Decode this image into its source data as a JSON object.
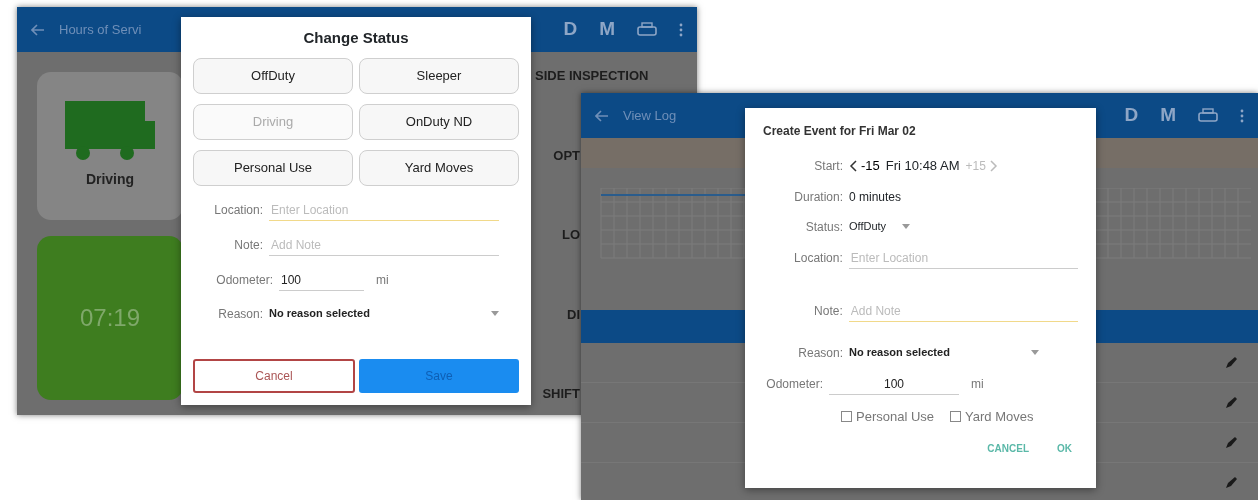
{
  "hours_of_service_screen": {
    "app_bar": {
      "title": "Hours of Servi",
      "buttons": [
        "D",
        "M"
      ]
    },
    "status_card": {
      "label": "Driving"
    },
    "timer_card": {
      "time": "07:19"
    },
    "side_labels": [
      "SIDE INSPECTION",
      "OPT",
      "LO",
      "DI",
      "SHIFT"
    ],
    "change_status_dialog": {
      "title": "Change Status",
      "status_buttons": [
        {
          "label": "OffDuty",
          "disabled": false
        },
        {
          "label": "Sleeper",
          "disabled": false
        },
        {
          "label": "Driving",
          "disabled": true
        },
        {
          "label": "OnDuty ND",
          "disabled": false
        },
        {
          "label": "Personal Use",
          "disabled": false
        },
        {
          "label": "Yard Moves",
          "disabled": false
        }
      ],
      "location": {
        "label": "Location:",
        "placeholder": "Enter Location",
        "focused": true
      },
      "note": {
        "label": "Note:",
        "placeholder": "Add Note",
        "focused": false
      },
      "odometer": {
        "label": "Odometer:",
        "value": "100",
        "unit": "mi"
      },
      "reason": {
        "label": "Reason:",
        "value": "No reason selected"
      },
      "actions": [
        {
          "label": "Cancel",
          "kind": "outline"
        },
        {
          "label": "Save",
          "kind": "primary"
        }
      ]
    }
  },
  "view_log_screen": {
    "app_bar": {
      "title": "View Log",
      "buttons": [
        "D",
        "M"
      ]
    },
    "create_event_dialog": {
      "title": "Create Event for Fri Mar 02",
      "start": {
        "label": "Start:",
        "back": "-15",
        "time": "Fri 10:48 AM",
        "forward": "+15",
        "forward_disabled": true
      },
      "duration": {
        "label": "Duration:",
        "value": "0 minutes"
      },
      "status": {
        "label": "Status:",
        "value": "OffDuty"
      },
      "location": {
        "label": "Location:",
        "placeholder": "Enter Location",
        "focused": false
      },
      "note": {
        "label": "Note:",
        "placeholder": "Add Note",
        "focused": true
      },
      "reason": {
        "label": "Reason:",
        "value": "No reason selected"
      },
      "odometer": {
        "label": "Odometer:",
        "value": "100",
        "unit": "mi"
      },
      "checkboxes": [
        {
          "label": "Personal Use",
          "checked": false
        },
        {
          "label": "Yard Moves",
          "checked": false
        }
      ],
      "actions": [
        "CANCEL",
        "OK"
      ]
    }
  }
}
